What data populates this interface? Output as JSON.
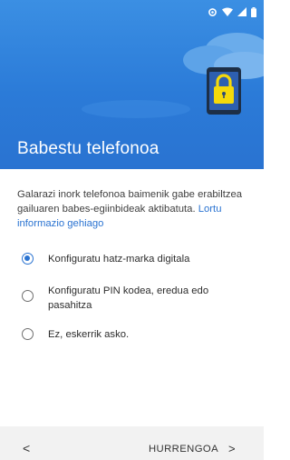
{
  "header": {
    "title": "Babestu telefonoa",
    "illustration": "phone-lock-icon",
    "background_color": "#2b7bd8"
  },
  "status_bar": {
    "icons": [
      "sync-icon",
      "wifi-icon",
      "signal-icon",
      "battery-icon"
    ]
  },
  "description": {
    "text": "Galarazi inork telefonoa baimenik gabe erabiltzea gailuaren babes-egiinbideak aktibatuta.",
    "link": "Lortu informazio gehiago"
  },
  "options": [
    {
      "label": "Konfiguratu hatz-marka digitala",
      "selected": true
    },
    {
      "label": "Konfiguratu PIN kodea, eredua edo pasahitza",
      "selected": false
    },
    {
      "label": "Ez, eskerrik asko.",
      "selected": false
    }
  ],
  "navigation": {
    "back_label": "<",
    "next_label": "HURRENGOA",
    "next_chevron": ">"
  },
  "colors": {
    "accent": "#2a73d1",
    "lock": "#f5d90a"
  }
}
